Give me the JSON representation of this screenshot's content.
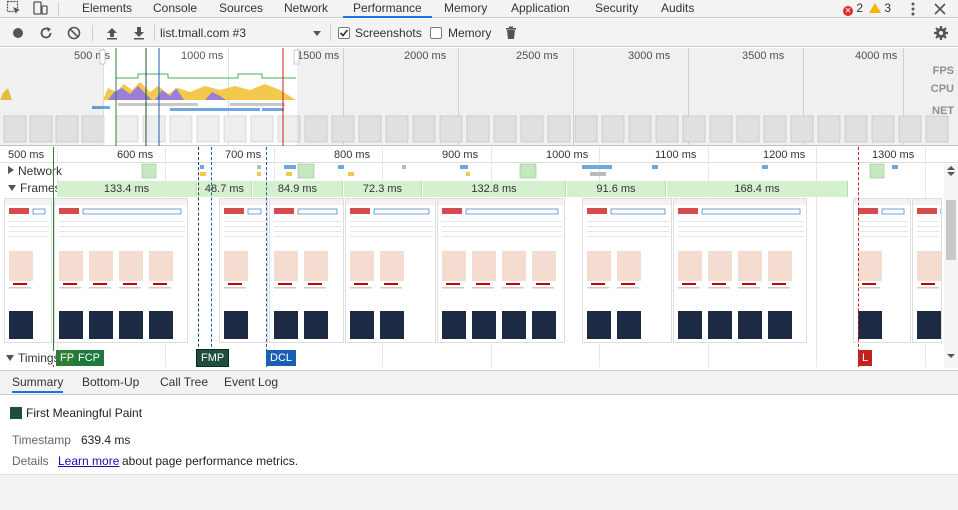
{
  "tabs": [
    {
      "label": "Elements"
    },
    {
      "label": "Console"
    },
    {
      "label": "Sources"
    },
    {
      "label": "Network"
    },
    {
      "label": "Performance"
    },
    {
      "label": "Memory"
    },
    {
      "label": "Application"
    },
    {
      "label": "Security"
    },
    {
      "label": "Audits"
    }
  ],
  "active_tab": "Performance",
  "badges": {
    "errors": "2",
    "warnings": "3"
  },
  "controls": {
    "profile_select": "list.tmall.com #3",
    "screenshots_label": "Screenshots",
    "screenshots_checked": true,
    "memory_label": "Memory",
    "memory_checked": false
  },
  "overview": {
    "ticks": [
      "500 ms",
      "1000 ms",
      "1500 ms",
      "2000 ms",
      "2500 ms",
      "3000 ms",
      "3500 ms",
      "4000 ms"
    ],
    "labels": {
      "fps": "FPS",
      "cpu": "CPU",
      "net": "NET"
    }
  },
  "ruler": {
    "ticks": [
      "500 ms",
      "600 ms",
      "700 ms",
      "800 ms",
      "900 ms",
      "1000 ms",
      "1100 ms",
      "1200 ms",
      "1300 ms"
    ]
  },
  "tracks": {
    "network": "Network",
    "frames": "Frames",
    "timings": "Timings"
  },
  "frames": [
    "133.4 ms",
    "48.7 ms",
    "84.9 ms",
    "72.3 ms",
    "132.8 ms",
    "91.6 ms",
    "168.4 ms"
  ],
  "markers": {
    "fp": "FP",
    "fcp": "FCP",
    "fmp": "FMP",
    "dcl": "DCL",
    "l": "L"
  },
  "subtabs": [
    {
      "label": "Summary"
    },
    {
      "label": "Bottom-Up"
    },
    {
      "label": "Call Tree"
    },
    {
      "label": "Event Log"
    }
  ],
  "summary": {
    "title": "First Meaningful Paint",
    "timestamp_label": "Timestamp",
    "timestamp_value": "639.4 ms",
    "details_label": "Details",
    "learn_more": "Learn more",
    "details_text": "about page performance metrics."
  },
  "colors": {
    "accent": "#1a73e8",
    "frame_green": "#d5f0cf",
    "fmp": "#1e4f3a",
    "fcp": "#1e7a3a",
    "dcl": "#1a5fb4",
    "load": "#c5221f",
    "cpu_yellow": "#f2c94c",
    "cpu_purple": "#9b7fd6"
  }
}
